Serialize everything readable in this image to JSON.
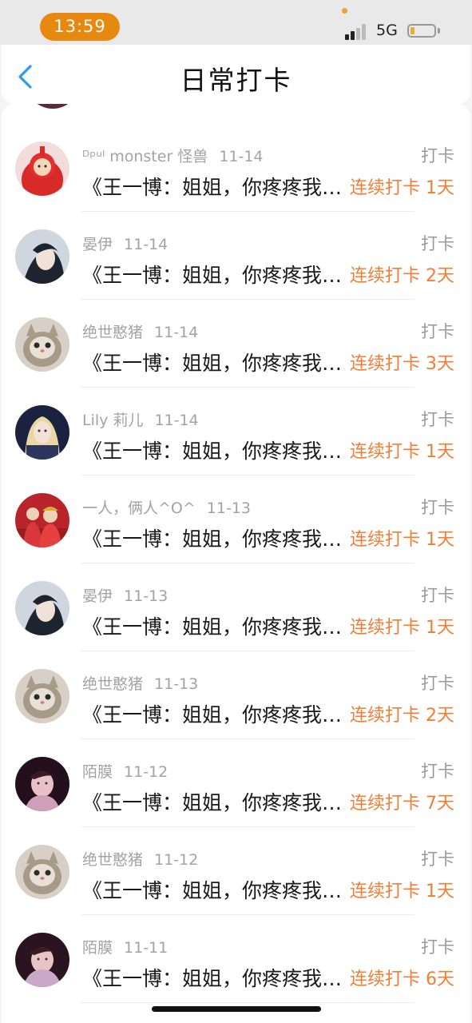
{
  "status_bar": {
    "time": "13:59",
    "network": "5G"
  },
  "header": {
    "title": "日常打卡",
    "back_icon": "chevron-left-icon"
  },
  "colors": {
    "accent_blue": "#2c9cf0",
    "streak_orange": "#f47c33",
    "time_pill": "#e8890f"
  },
  "records": [
    {
      "user": "ᴰᵖᵘˡ monster 怪兽",
      "date": "11-14",
      "tag": "打卡",
      "content": "《王一博：姐姐，你疼疼我好不好》",
      "streak": "连续打卡 1天"
    },
    {
      "user": "晏伊",
      "date": "11-14",
      "tag": "打卡",
      "content": "《王一博：姐姐，你疼疼我好不好》",
      "streak": "连续打卡 2天"
    },
    {
      "user": "绝世憨猪",
      "date": "11-14",
      "tag": "打卡",
      "content": "《王一博：姐姐，你疼疼我好不好》",
      "streak": "连续打卡 3天"
    },
    {
      "user": "Lily 莉儿",
      "date": "11-14",
      "tag": "打卡",
      "content": "《王一博：姐姐，你疼疼我好不好》",
      "streak": "连续打卡 1天"
    },
    {
      "user": "一人，俩人^O^",
      "date": "11-13",
      "tag": "打卡",
      "content": "《王一博：姐姐，你疼疼我好不好》",
      "streak": "连续打卡 1天"
    },
    {
      "user": "晏伊",
      "date": "11-13",
      "tag": "打卡",
      "content": "《王一博：姐姐，你疼疼我好不好》",
      "streak": "连续打卡 1天"
    },
    {
      "user": "绝世憨猪",
      "date": "11-13",
      "tag": "打卡",
      "content": "《王一博：姐姐，你疼疼我好不好》",
      "streak": "连续打卡 2天"
    },
    {
      "user": "陌膜",
      "date": "11-12",
      "tag": "打卡",
      "content": "《王一博：姐姐，你疼疼我好不好》",
      "streak": "连续打卡 7天"
    },
    {
      "user": "绝世憨猪",
      "date": "11-12",
      "tag": "打卡",
      "content": "《王一博：姐姐，你疼疼我好不好》",
      "streak": "连续打卡 1天"
    },
    {
      "user": "陌膜",
      "date": "11-11",
      "tag": "打卡",
      "content": "《王一博：姐姐，你疼疼我好不好》",
      "streak": "连续打卡 6天"
    }
  ]
}
